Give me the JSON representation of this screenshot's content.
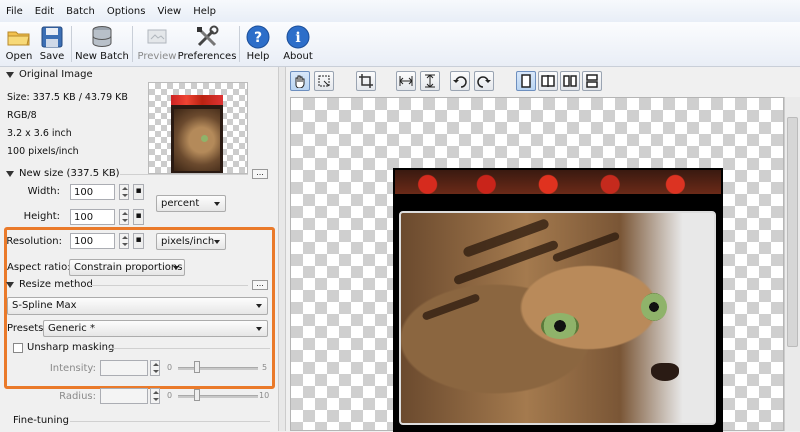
{
  "menu": [
    "File",
    "Edit",
    "Batch",
    "Options",
    "View",
    "Help"
  ],
  "toolbar": {
    "open": "Open",
    "save": "Save",
    "new_batch": "New Batch",
    "preview": "Preview",
    "preferences": "Preferences",
    "help": "Help",
    "about": "About"
  },
  "original": {
    "header": "Original Image",
    "size": "Size: 337.5 KB / 43.79 KB",
    "mode": "RGB/8",
    "dims": "3.2 x 3.6 inch",
    "res": "100 pixels/inch"
  },
  "new_size": {
    "header": "New size (337.5 KB)",
    "width_label": "Width:",
    "width_value": "100",
    "height_label": "Height:",
    "height_value": "100",
    "resolution_label": "Resolution:",
    "resolution_value": "100",
    "unit": "percent",
    "res_unit": "pixels/inch",
    "aspect_label": "Aspect ratio:",
    "aspect_value": "Constrain proportions",
    "more": "..."
  },
  "resize": {
    "header": "Resize method",
    "method": "S-Spline Max",
    "more": "..."
  },
  "presets": {
    "label": "Presets:",
    "value": "Generic *"
  },
  "unsharp": {
    "label": "Unsharp masking",
    "intensity_label": "Intensity:",
    "intensity_min": "0",
    "intensity_max": "5",
    "radius_label": "Radius:",
    "radius_min": "0",
    "radius_max": "10"
  },
  "finetuning": {
    "label": "Fine-tuning"
  },
  "colors": {
    "highlight": "#ea7a2a",
    "accent": "#3a7bd5"
  }
}
